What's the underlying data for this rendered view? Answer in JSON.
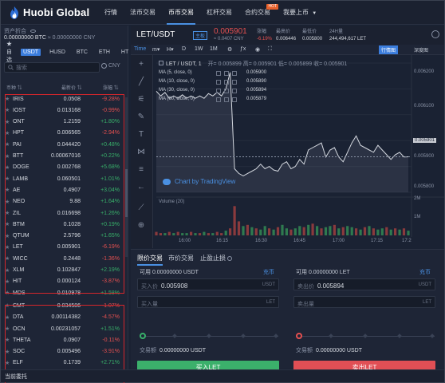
{
  "nav": {
    "logo": "Huobi Global",
    "items": [
      {
        "label": "行情"
      },
      {
        "label": "法币交易"
      },
      {
        "label": "币币交易"
      },
      {
        "label": "杠杆交易"
      },
      {
        "label": "合约交易"
      },
      {
        "label": "我要上币"
      }
    ],
    "hot_badge": "HOT",
    "active_index": 2
  },
  "assets": {
    "title": "资产折合",
    "btc": "0.00000000 BTC",
    "cny": "≈ 0.00000000 CNY"
  },
  "quote_tabs": {
    "favorites": "自选",
    "tabs": [
      "USDT",
      "HUSD",
      "BTC",
      "ETH",
      "HT"
    ],
    "active": "USDT"
  },
  "search": {
    "placeholder": "搜索"
  },
  "cny_toggle": "CNY",
  "market_table": {
    "headers": [
      "币种",
      "最新价",
      "涨幅"
    ],
    "rows": [
      {
        "symbol": "IRIS",
        "price": "0.0508",
        "change": "-9.28%",
        "dir": "down"
      },
      {
        "symbol": "IOST",
        "price": "0.013168",
        "change": "-0.99%",
        "dir": "down"
      },
      {
        "symbol": "ONT",
        "price": "1.2159",
        "change": "+1.80%",
        "dir": "up"
      },
      {
        "symbol": "HPT",
        "price": "0.006565",
        "change": "-2.94%",
        "dir": "down"
      },
      {
        "symbol": "PAI",
        "price": "0.044420",
        "change": "+0.48%",
        "dir": "up"
      },
      {
        "symbol": "BTT",
        "price": "0.00067016",
        "change": "+0.22%",
        "dir": "up"
      },
      {
        "symbol": "DOGE",
        "price": "0.002768",
        "change": "+5.68%",
        "dir": "up"
      },
      {
        "symbol": "LAMB",
        "price": "0.060501",
        "change": "+1.01%",
        "dir": "up"
      },
      {
        "symbol": "AE",
        "price": "0.4907",
        "change": "+3.04%",
        "dir": "up"
      },
      {
        "symbol": "NEO",
        "price": "9.88",
        "change": "+1.64%",
        "dir": "up"
      },
      {
        "symbol": "ZIL",
        "price": "0.016698",
        "change": "+1.26%",
        "dir": "up"
      },
      {
        "symbol": "BTM",
        "price": "0.1028",
        "change": "+0.19%",
        "dir": "up"
      },
      {
        "symbol": "QTUM",
        "price": "2.5796",
        "change": "+1.65%",
        "dir": "up"
      },
      {
        "symbol": "LET",
        "price": "0.005901",
        "change": "-6.19%",
        "dir": "down"
      },
      {
        "symbol": "WICC",
        "price": "0.2448",
        "change": "-1.36%",
        "dir": "down"
      },
      {
        "symbol": "XLM",
        "price": "0.102847",
        "change": "+2.19%",
        "dir": "up"
      },
      {
        "symbol": "HIT",
        "price": "0.000124",
        "change": "-3.87%",
        "dir": "down"
      },
      {
        "symbol": "MDS",
        "price": "0.010978",
        "change": "+1.58%",
        "dir": "up"
      },
      {
        "symbol": "CMT",
        "price": "0.034586",
        "change": "-1.07%",
        "dir": "down"
      },
      {
        "symbol": "DTA",
        "price": "0.00114382",
        "change": "-4.57%",
        "dir": "down"
      },
      {
        "symbol": "OCN",
        "price": "0.00231057",
        "change": "+1.51%",
        "dir": "up"
      },
      {
        "symbol": "THETA",
        "price": "0.0907",
        "change": "-0.11%",
        "dir": "down"
      },
      {
        "symbol": "SOC",
        "price": "0.005496",
        "change": "-3.91%",
        "dir": "down"
      },
      {
        "symbol": "ELF",
        "price": "0.1739",
        "change": "+2.71%",
        "dir": "up"
      }
    ]
  },
  "ticker": {
    "pair": "LET/USDT",
    "tag": "主板",
    "last": "0.005901",
    "last_cny": "≈ 0.0407 CNY",
    "stats": [
      {
        "label": "涨幅",
        "value": "-6.19%",
        "red": true
      },
      {
        "label": "最高价",
        "value": "0.006446",
        "red": false
      },
      {
        "label": "最低价",
        "value": "0.005800",
        "red": false
      },
      {
        "label": "24H量",
        "value": "244,494,617 LET",
        "red": false
      }
    ]
  },
  "chart_toolbar": {
    "tabs": [
      "Time",
      "m",
      "H",
      "D",
      "1W",
      "1M"
    ],
    "active": "Time",
    "right": [
      "行情图",
      "深度图"
    ],
    "right_active": "行情图"
  },
  "chart": {
    "legend_pair": "LET / USDT, 1",
    "legend_ohlc": "开= 0.005899  高= 0.005901  低= 0.005899  收= 0.005901",
    "ma": [
      {
        "label": "MA (5, close, 0)",
        "value": "0.005900"
      },
      {
        "label": "MA (10, close, 0)",
        "value": "0.005890"
      },
      {
        "label": "MA (30, close, 0)",
        "value": "0.005894"
      },
      {
        "label": "MA (60, close, 0)",
        "value": "0.005879"
      }
    ],
    "watermark": "Chart by TradingView",
    "volume_label": "Volume (20)",
    "y_ticks": [
      "0.006200",
      "0.006100",
      "0.005901",
      "0.005900",
      "0.005800",
      "2M",
      "1M"
    ],
    "last_price_box": "0.005901",
    "x_ticks": [
      "16:00",
      "16:15",
      "16:30",
      "16:45",
      "17:00",
      "17:15",
      "17:2"
    ]
  },
  "chart_data": {
    "type": "line",
    "title": "",
    "series": [
      {
        "values": [
          0.00618,
          0.00616,
          0.006175,
          0.00615,
          0.00616,
          0.00615,
          0.006165,
          0.00615,
          0.00616,
          0.00615,
          0.00616,
          0.00615,
          0.00617,
          0.00616,
          0.006175,
          0.00616,
          0.00619,
          0.00626,
          0.00585,
          0.00583,
          0.00582,
          0.00583,
          0.00584,
          0.00585,
          0.00587,
          0.00585,
          0.00586,
          0.005845,
          0.00584,
          0.00587,
          0.00588,
          0.00585,
          0.00586,
          0.00589,
          0.00587,
          0.00593,
          0.00594,
          0.00595,
          0.00596,
          0.0059,
          0.00593,
          0.00594,
          0.0059,
          0.00588,
          0.00592,
          0.00596,
          0.00599,
          0.00595,
          0.00594,
          0.00593,
          0.00592,
          0.00595,
          0.00593,
          0.00591,
          0.00589,
          0.00591,
          0.00592,
          0.0059,
          0.005901
        ]
      }
    ],
    "volume": [
      0.3,
      0.2,
      0.2,
      0.3,
      0.2,
      0.3,
      0.2,
      0.2,
      0.3,
      0.2,
      0.2,
      0.3,
      0.2,
      0.2,
      0.3,
      0.2,
      0.4,
      0.6,
      2.5,
      1.2,
      0.8,
      0.9,
      0.7,
      0.6,
      0.5,
      0.8,
      0.6,
      0.5,
      0.7,
      0.9,
      0.6,
      0.5,
      0.6,
      0.8,
      0.7,
      0.9,
      1.0,
      0.8,
      0.6,
      0.7,
      0.8,
      0.9,
      0.6,
      0.7,
      0.8,
      0.7,
      0.6,
      0.5,
      0.7,
      0.8,
      0.6,
      0.5,
      0.6,
      0.7,
      0.5,
      0.6,
      0.5,
      0.6,
      0.4
    ],
    "volume_colors": [
      "r",
      "r",
      "g",
      "r",
      "g",
      "r",
      "g",
      "g",
      "r",
      "g",
      "r",
      "g",
      "r",
      "g",
      "r",
      "r",
      "g",
      "r",
      "r",
      "r",
      "g",
      "r",
      "g",
      "r",
      "g",
      "g",
      "r",
      "g",
      "r",
      "g",
      "g",
      "r",
      "g",
      "g",
      "r",
      "g",
      "r",
      "g",
      "r",
      "g",
      "g",
      "r",
      "g",
      "r",
      "g",
      "g",
      "r",
      "g",
      "r",
      "g",
      "r",
      "g",
      "g",
      "r",
      "g",
      "r",
      "g",
      "r",
      "g"
    ],
    "ylim": [
      0.00575,
      0.0063
    ],
    "xlabel": "",
    "ylabel": ""
  },
  "order_panel": {
    "tabs": [
      "限价交易",
      "市价交易",
      "止盈止损"
    ],
    "active": "限价交易",
    "buy": {
      "available": "可用  0.00000000  USDT",
      "deposit": "充币",
      "price_label": "买入价",
      "price_value": "0.005908",
      "price_unit": "USDT",
      "qty_label": "买入量",
      "qty_unit": "LET",
      "amount_label": "交易额",
      "amount_value": "0.00000000 USDT",
      "button": "买入LET"
    },
    "sell": {
      "available": "可用  0.00000000  LET",
      "deposit": "充币",
      "price_label": "卖出价",
      "price_value": "0.005894",
      "price_unit": "USDT",
      "qty_label": "卖出量",
      "qty_unit": "LET",
      "amount_label": "交易额",
      "amount_value": "0.00000000 USDT",
      "button": "卖出LET"
    }
  },
  "bottom": {
    "label": "当前委托"
  },
  "colors": {
    "up": "#38b06a",
    "down": "#e55050",
    "accent": "#3b7ddd",
    "highlight": "#d6262b"
  }
}
